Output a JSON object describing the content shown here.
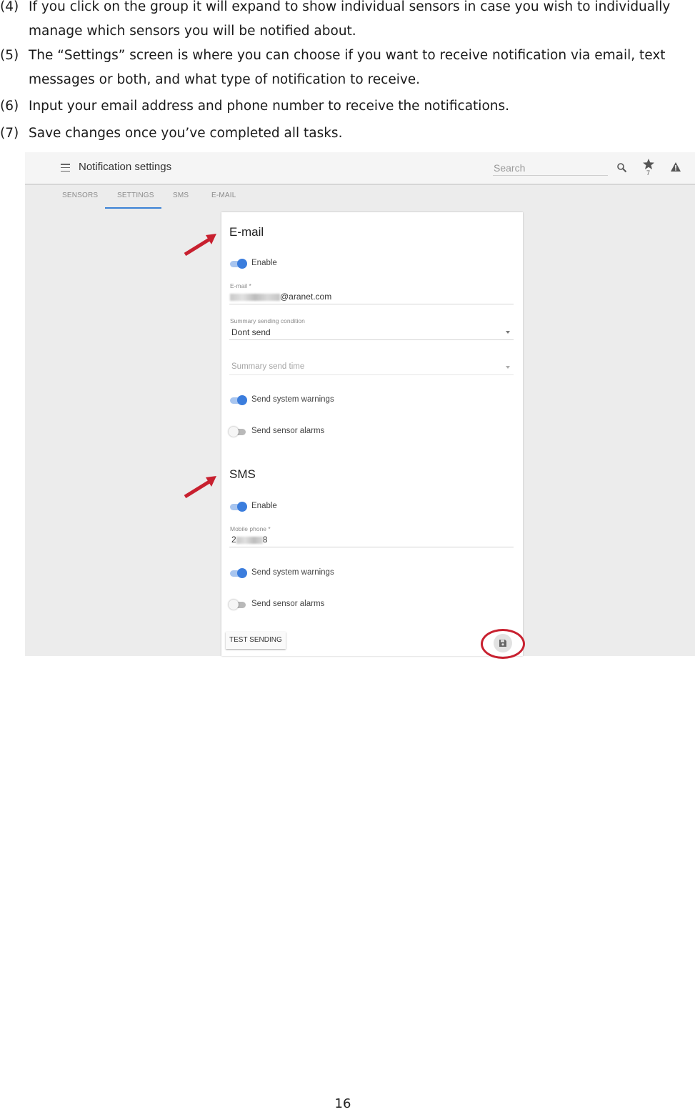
{
  "steps": [
    {
      "num": "(4)",
      "text": "If you click on the group it will expand to show individual sensors in case you wish to individually manage which sensors you will be notified about."
    },
    {
      "num": "(5)",
      "text": "The “Settings” screen is where you can choose if you want to receive notification via email, text messages or both, and what type of notification to receive."
    },
    {
      "num": "(6)",
      "text": "Input your email address and phone number to receive the notifications."
    },
    {
      "num": "(7)",
      "text": "Save changes once you’ve completed all tasks."
    }
  ],
  "screenshot": {
    "app_title": "Notification settings",
    "search_placeholder": "Search",
    "star_count": "7",
    "tabs": [
      "SENSORS",
      "SETTINGS",
      "SMS",
      "E-MAIL"
    ],
    "active_tab": "SETTINGS",
    "email": {
      "title": "E-mail",
      "enable_label": "Enable",
      "enable_on": true,
      "email_field_label": "E-mail *",
      "email_value_suffix": "@aranet.com",
      "summary_condition_label": "Summary sending condition",
      "summary_condition_value": "Dont send",
      "summary_time_placeholder": "Summary send time",
      "system_warnings_label": "Send system warnings",
      "system_warnings_on": true,
      "sensor_alarms_label": "Send sensor alarms",
      "sensor_alarms_on": false
    },
    "sms": {
      "title": "SMS",
      "enable_label": "Enable",
      "enable_on": true,
      "phone_field_label": "Mobile phone *",
      "phone_value_start": "2",
      "phone_value_end": "8",
      "system_warnings_label": "Send system warnings",
      "system_warnings_on": true,
      "sensor_alarms_label": "Send sensor alarms",
      "sensor_alarms_on": false
    },
    "test_button": "TEST SENDING",
    "accent_color": "#3b7ddd",
    "annotation_color": "#c8202f"
  },
  "page_number": "16"
}
